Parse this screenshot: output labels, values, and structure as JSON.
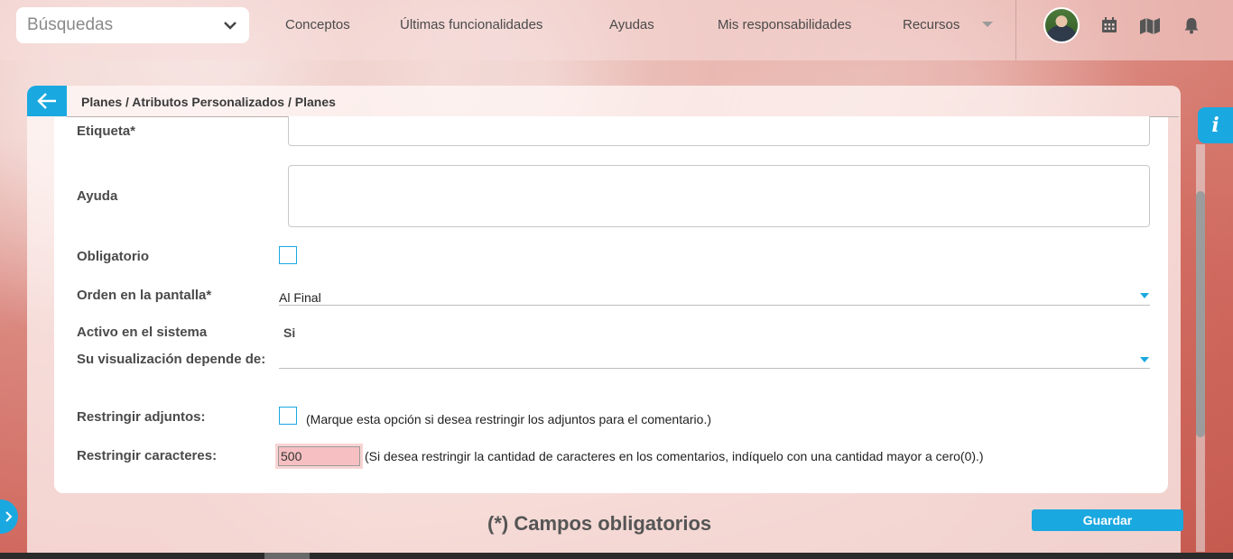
{
  "topbar": {
    "search_value": "Búsquedas",
    "nav": [
      {
        "label": "Conceptos"
      },
      {
        "label": "Últimas funcionalidades"
      },
      {
        "label": "Ayudas"
      },
      {
        "label": "Mis responsabilidades"
      },
      {
        "label": "Recursos"
      }
    ],
    "icons": [
      "chevron-down-icon",
      "calendar-icon",
      "map-icon",
      "bell-icon"
    ]
  },
  "breadcrumb": "Planes / Atributos Personalizados / Planes",
  "form": {
    "etiqueta_label": "Etiqueta*",
    "etiqueta_value": "",
    "ayuda_label": "Ayuda",
    "ayuda_value": "",
    "obligatorio_label": "Obligatorio",
    "obligatorio_checked": false,
    "orden_label": "Orden en la pantalla*",
    "orden_value": "Al Final",
    "activo_label": "Activo en el sistema",
    "activo_value": "Si",
    "visualizacion_label": "Su visualización depende de:",
    "visualizacion_value": "",
    "restringir_adjuntos_label": "Restringir adjuntos:",
    "restringir_adjuntos_checked": false,
    "restringir_adjuntos_hint": "(Marque esta opción si desea restringir los adjuntos para el comentario.)",
    "restringir_caracteres_label": "Restringir caracteres:",
    "restringir_caracteres_value": "500",
    "restringir_caracteres_hint": "(Si desea restringir la cantidad de caracteres en los comentarios, indíquelo con una cantidad mayor a cero(0).)"
  },
  "footer": {
    "required_note": "(*) Campos obligatorios",
    "save_label": "Guardar"
  },
  "info_tab_label": "i",
  "colors": {
    "accent": "#1aa8e0",
    "invalid_input": "#f6bfc1"
  }
}
